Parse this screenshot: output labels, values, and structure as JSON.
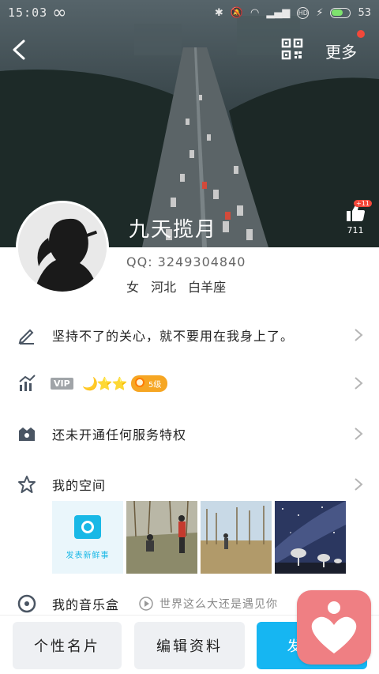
{
  "status_bar": {
    "time": "15:03",
    "infinity": "∞",
    "hd": "HD",
    "battery_level": "53"
  },
  "header": {
    "back_icon": "back-chevron-icon",
    "qr_icon": "qr-code-icon",
    "more_label": "更多"
  },
  "profile": {
    "nickname": "九天揽月",
    "qq": "QQ: 3249304840",
    "location": "女 河北 白羊座",
    "likes": "711",
    "like_badge": "+11"
  },
  "rows": {
    "signature": "坚持不了的关心，就不要用在我身上了。",
    "vip_tag": "VIP",
    "vip_stars": "🌙⭐⭐",
    "level": "5级",
    "service": "还未开通任何服务特权",
    "space": "我的空间",
    "music": "我的音乐盒",
    "music_tagline": "世界这么大还是遇见你"
  },
  "photos": {
    "new_label": "发表新鲜事"
  },
  "bottom": {
    "card_button": "个性名片",
    "edit_button": "编辑资料",
    "post_button": "发消息"
  },
  "colors": {
    "accent_blue": "#16b6f2",
    "badge_red": "#f2483a",
    "level_orange": "#f6a623",
    "widget_pink": "#ef7f83"
  }
}
